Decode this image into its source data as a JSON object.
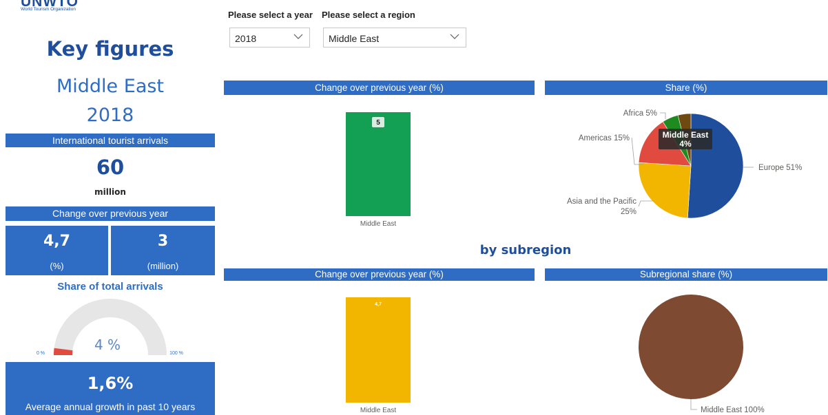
{
  "logo": {
    "name": "UNWTO",
    "tagline": "World Tourism Organization"
  },
  "filters": {
    "year_label": "Please select a year",
    "region_label": "Please select a region",
    "year_value": "2018",
    "region_value": "Middle East"
  },
  "left": {
    "title": "Key figures",
    "region": "Middle East",
    "year": "2018",
    "arrivals_header": "International tourist arrivals",
    "arrivals_value": "60",
    "arrivals_unit": "million",
    "change_header": "Change over previous year",
    "change_pct_value": "4,7",
    "change_pct_unit": "(%)",
    "change_abs_value": "3",
    "change_abs_unit": "(million)",
    "share_header": "Share of total arrivals",
    "gauge_value": "4 %",
    "gauge_min": "0 %",
    "gauge_max": "100 %",
    "gauge_fraction": 0.04,
    "growth_value": "1,6%",
    "growth_label": "Average annual growth in past 10 years"
  },
  "colors": {
    "header_blue": "#2f6cc4",
    "title_blue": "#1f4e9c",
    "green": "#13a055",
    "yellow": "#f2b600",
    "europe": "#1f4e9c",
    "asia": "#f2b600",
    "americas": "#e04a3f",
    "africa": "#1f8a1f",
    "middle_east": "#6e4a11",
    "subregion": "#7e4a31",
    "gauge_fill": "#e04a3f",
    "gauge_track": "#e6e6e6"
  },
  "section_title": "by subregion",
  "chart_data": [
    {
      "type": "bar",
      "title": "Change over previous year (%)",
      "categories": [
        "Middle East"
      ],
      "values": [
        5
      ],
      "data_labels": [
        "5"
      ],
      "color": "#13a055"
    },
    {
      "type": "pie",
      "title": "Share (%)",
      "categories": [
        "Europe",
        "Asia and the Pacific",
        "Americas",
        "Africa",
        "Middle East"
      ],
      "values": [
        51,
        25,
        15,
        5,
        4
      ],
      "labels": [
        "Europe 51%",
        "Asia and the Pacific 25%",
        "Americas 15%",
        "Africa 5%",
        "Middle East 4%"
      ],
      "tooltip": {
        "name": "Middle East",
        "value": "4%"
      }
    },
    {
      "type": "bar",
      "title": "Change over previous year (%)",
      "categories": [
        "Middle East"
      ],
      "values": [
        4.7
      ],
      "data_labels": [
        "4,7"
      ],
      "color": "#f2b600"
    },
    {
      "type": "pie",
      "title": "Subregional share (%)",
      "categories": [
        "Middle East"
      ],
      "values": [
        100
      ],
      "labels": [
        "Middle East 100%"
      ]
    }
  ]
}
